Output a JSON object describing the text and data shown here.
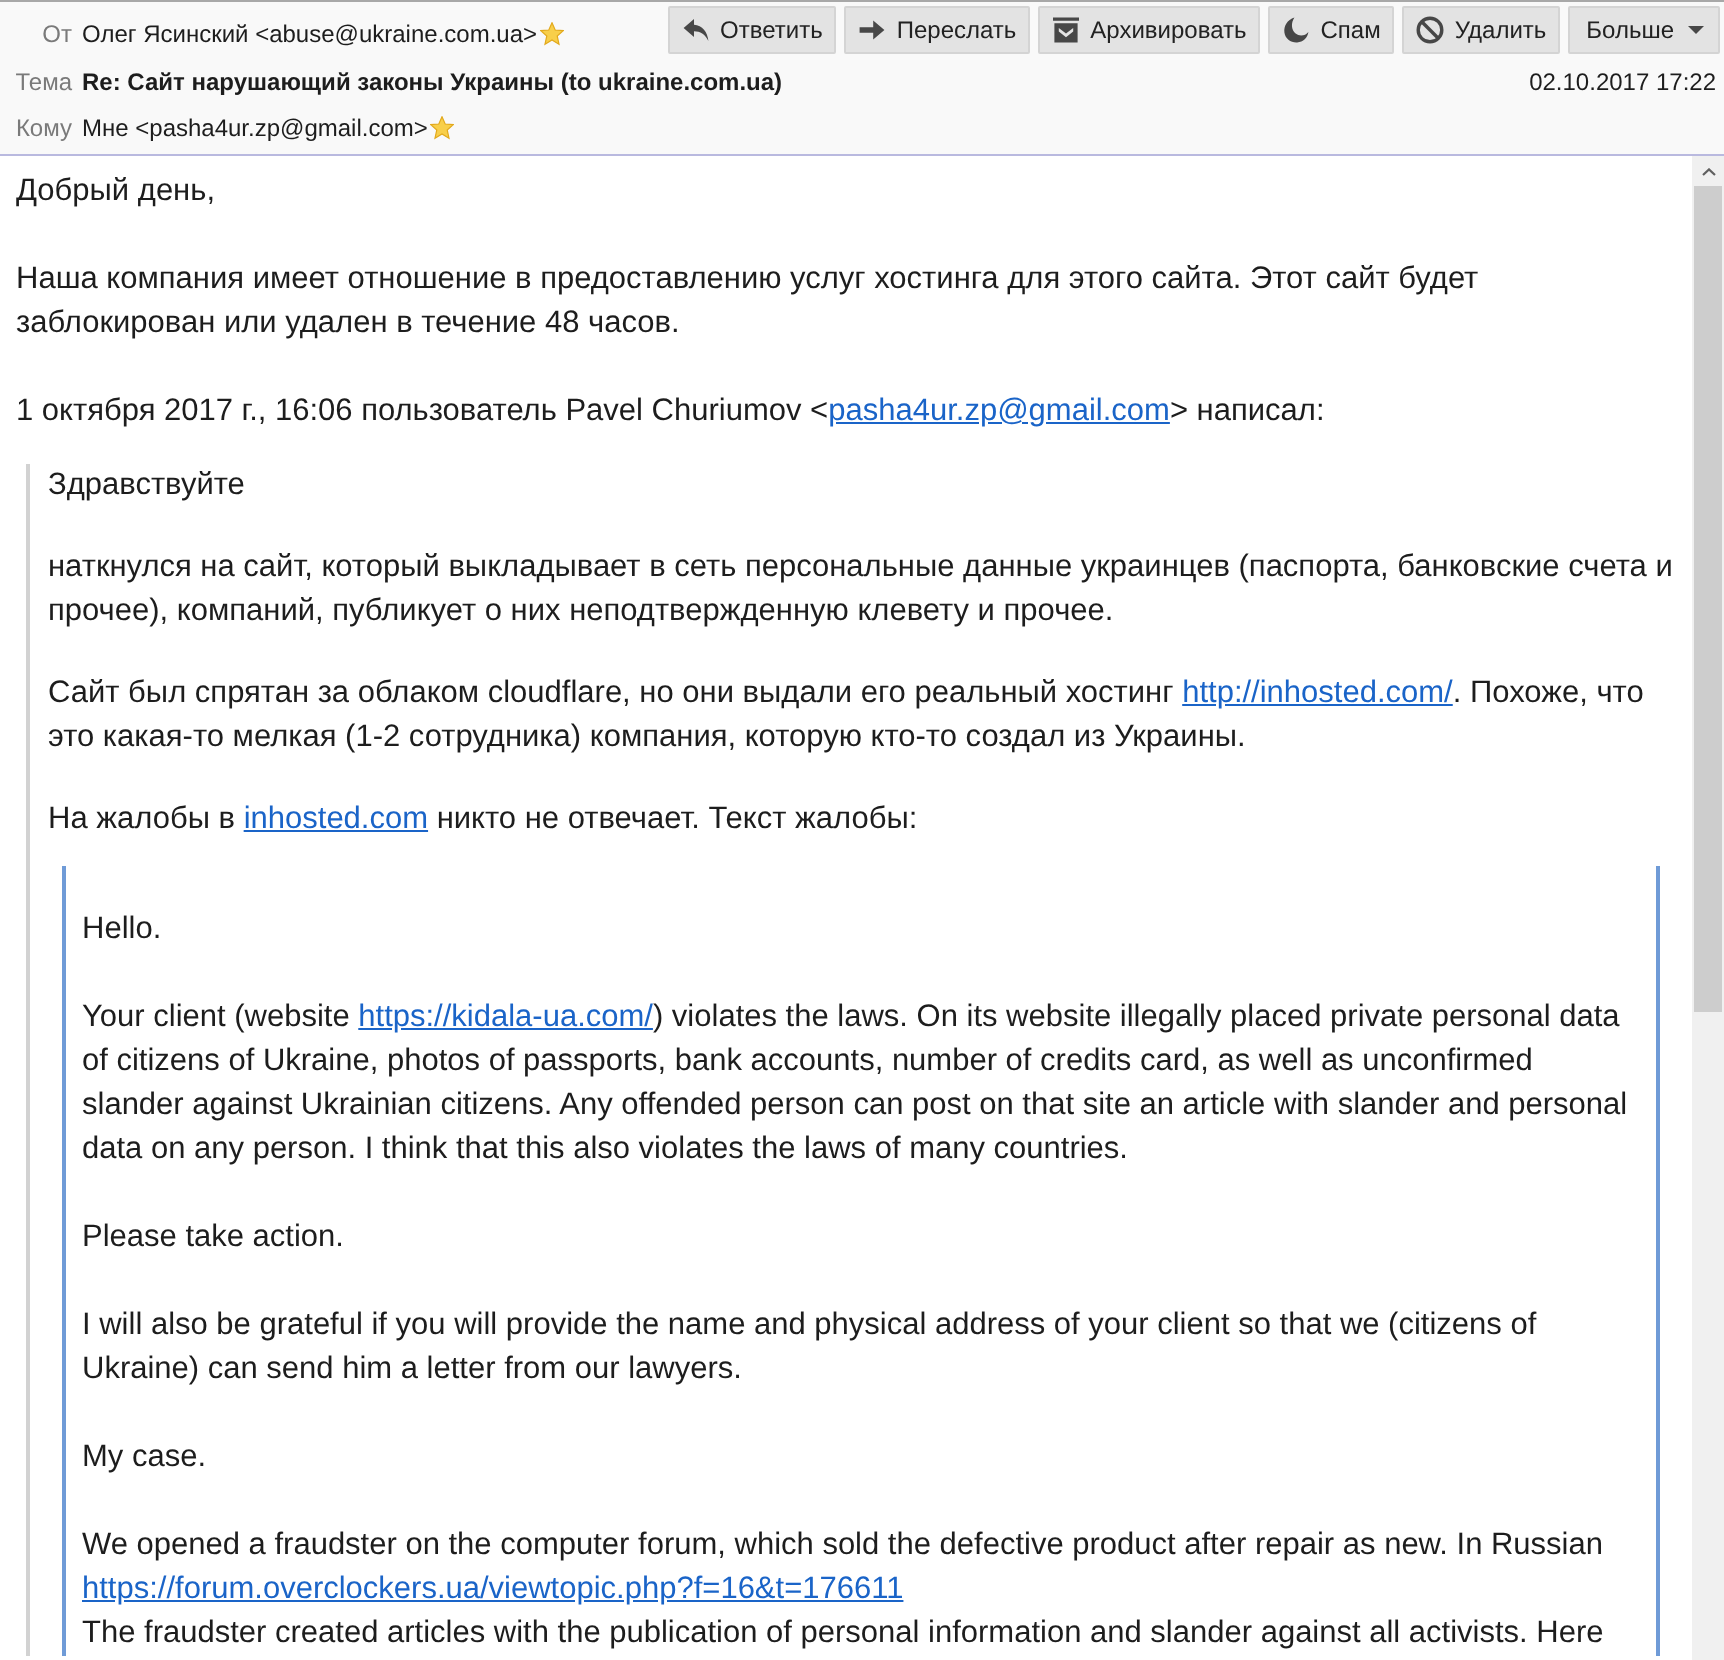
{
  "header": {
    "fields": [
      {
        "kind": "sender",
        "label": "От",
        "value": "Олег Ясинский <abuse@ukraine.com.ua>",
        "starred": true
      },
      {
        "kind": "subject",
        "label": "Тема",
        "value": "Re: Сайт нарушающий законы Украины (to ukraine.com.ua)",
        "date": "02.10.2017 17:22"
      },
      {
        "kind": "recipient",
        "label": "Кому",
        "value": "Мне <pasha4ur.zp@gmail.com>",
        "starred": true
      }
    ],
    "toolbar": [
      {
        "kind": "reply",
        "label": "Ответить"
      },
      {
        "kind": "forward",
        "label": "Переслать"
      },
      {
        "kind": "archive",
        "label": "Архивировать"
      },
      {
        "kind": "spam",
        "label": "Спам"
      },
      {
        "kind": "delete",
        "label": "Удалить"
      },
      {
        "kind": "more",
        "label": "Больше"
      }
    ]
  },
  "body": [
    {
      "kind": "paragraph",
      "parts": [
        {
          "kind": "text",
          "text": "Добрый день,"
        }
      ]
    },
    {
      "kind": "paragraph",
      "parts": [
        {
          "kind": "text",
          "text": "Наша компания имеет отношение в предоставлению услуг хостинга для этого сайта. Этот сайт будет заблокирован или удален в течение 48 часов."
        }
      ]
    },
    {
      "kind": "paragraph",
      "parts": [
        {
          "kind": "text",
          "text": "1 октября 2017 г., 16:06 пользователь Pavel Churiumov <"
        },
        {
          "kind": "link",
          "text": "pasha4ur.zp@gmail.com"
        },
        {
          "kind": "text",
          "text": "> написал:"
        }
      ]
    },
    {
      "kind": "quote",
      "blocks": [
        {
          "kind": "paragraph",
          "parts": [
            {
              "kind": "text",
              "text": "Здравствуйте"
            }
          ]
        },
        {
          "kind": "paragraph",
          "parts": [
            {
              "kind": "text",
              "text": "наткнулся на сайт, который выкладывает в сеть персональные данные украинцев (паспорта, банковские счета и прочее), компаний, публикует о них неподтвержденную клевету и прочее."
            }
          ]
        },
        {
          "kind": "paragraph",
          "parts": [
            {
              "kind": "text",
              "text": "Сайт был спрятан за облаком cloudflare, но они выдали его реальный хостинг "
            },
            {
              "kind": "link",
              "text": "http://inhosted.com/"
            },
            {
              "kind": "text",
              "text": ". Похоже, что это какая-то мелкая (1-2 сотрудника) компания, которую кто-то создал из Украины."
            }
          ]
        },
        {
          "kind": "paragraph",
          "parts": [
            {
              "kind": "text",
              "text": "На жалобы в "
            },
            {
              "kind": "link",
              "text": "inhosted.com"
            },
            {
              "kind": "text",
              "text": " никто не отвечает. Текст жалобы:"
            }
          ]
        },
        {
          "kind": "quote",
          "blocks": [
            {
              "kind": "paragraph",
              "parts": [
                {
                  "kind": "text",
                  "text": "Hello."
                }
              ]
            },
            {
              "kind": "paragraph",
              "parts": [
                {
                  "kind": "text",
                  "text": "Your client (website "
                },
                {
                  "kind": "link",
                  "text": "https://kidala-ua.com/"
                },
                {
                  "kind": "text",
                  "text": ") violates the laws. On its website illegally placed private personal data of citizens of Ukraine, photos of passports, bank accounts, number of credits card, as well as unconfirmed slander against Ukrainian citizens. Any offended person can post on that site an article with slander and personal data on any person. I think that this also violates the laws of many countries."
                }
              ]
            },
            {
              "kind": "paragraph",
              "parts": [
                {
                  "kind": "text",
                  "text": "Please take action."
                }
              ]
            },
            {
              "kind": "paragraph",
              "parts": [
                {
                  "kind": "text",
                  "text": "I will also be grateful if you will provide the name and physical address of your client so that we (citizens of Ukraine) can send him a letter from our lawyers."
                }
              ]
            },
            {
              "kind": "paragraph",
              "parts": [
                {
                  "kind": "text",
                  "text": "My case."
                }
              ]
            },
            {
              "kind": "paragraph",
              "parts": [
                {
                  "kind": "text",
                  "text": "We opened a fraudster on the computer forum, which sold the defective product after repair as new. In Russian "
                },
                {
                  "kind": "link",
                  "text": "https://forum.overclockers.ua/viewtopic.php?f=16&t=176611"
                },
                {
                  "kind": "break"
                },
                {
                  "kind": "text",
                  "text": "The fraudster created articles with the publication of personal information and slander against all activists. Here"
                }
              ]
            }
          ]
        }
      ]
    }
  ]
}
